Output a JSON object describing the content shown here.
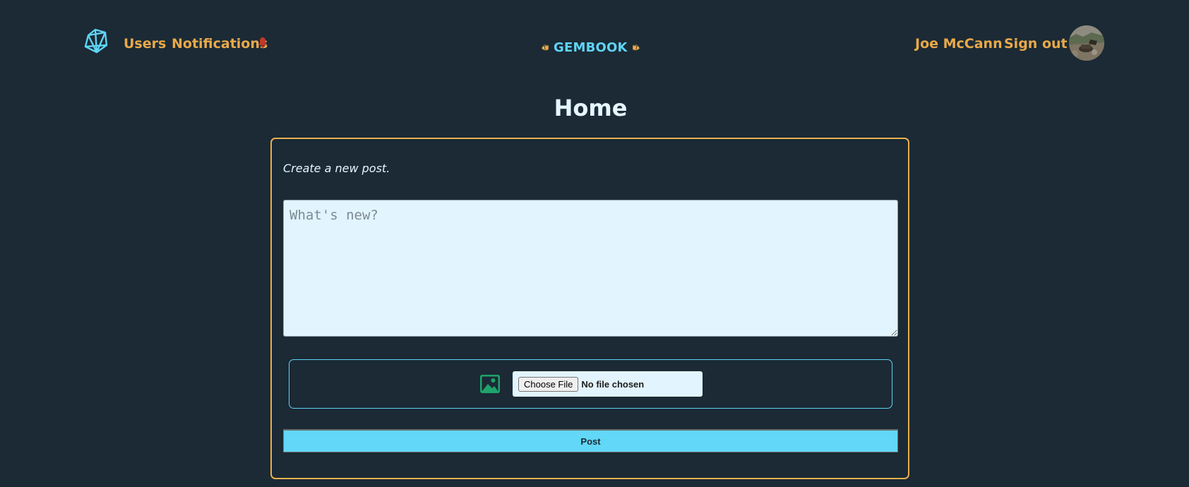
{
  "header": {
    "logo_icon": "diamond-icon",
    "nav": {
      "users_label": "Users",
      "notifications_label": "Notifications",
      "notification_icon": "bell-icon"
    },
    "brand": {
      "name": "GEMBOOK",
      "gem_icon": "gem-icon"
    },
    "user": {
      "name": "Joe McCann",
      "signout_label": "Sign out",
      "avatar": "user-avatar"
    }
  },
  "main": {
    "title": "Home",
    "composer": {
      "hint": "Create a new post.",
      "placeholder": "What's new?",
      "value": "",
      "image_icon": "image-icon",
      "file_button_label": "Choose File",
      "file_status": "No file chosen",
      "submit_label": "Post"
    }
  },
  "colors": {
    "background": "#1b2a35",
    "accent_orange": "#e9a94a",
    "accent_cyan": "#5fd4f5",
    "bell_red": "#c0392b",
    "image_icon_green": "#1fa36b",
    "input_bg": "#e2f4fd"
  }
}
